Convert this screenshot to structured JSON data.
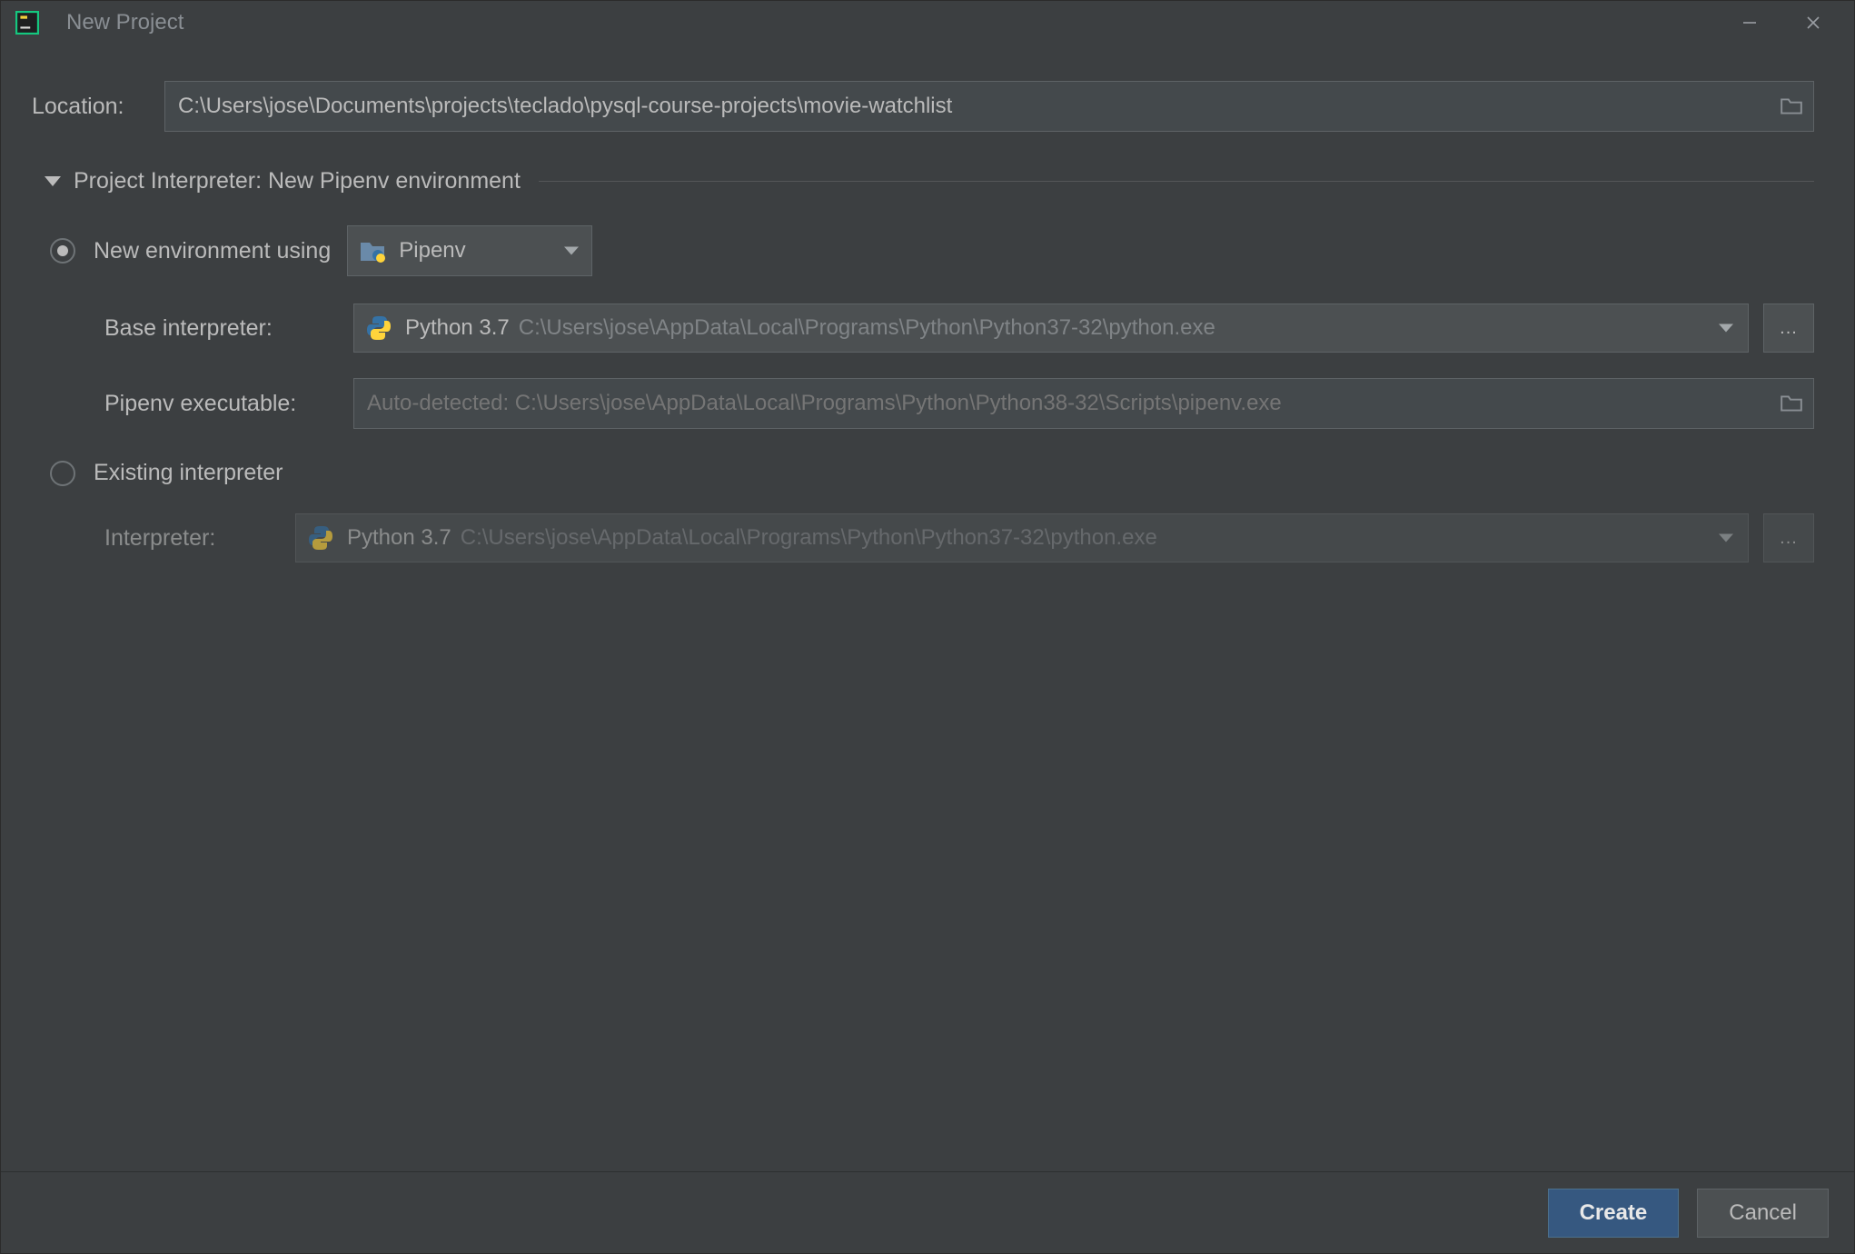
{
  "titlebar": {
    "title": "New Project"
  },
  "location": {
    "label": "Location:",
    "value": "C:\\Users\\jose\\Documents\\projects\\teclado\\pysql-course-projects\\movie-watchlist"
  },
  "section": {
    "heading": "Project Interpreter: New Pipenv environment"
  },
  "new_env": {
    "radio_label": "New environment using",
    "tool": "Pipenv",
    "base_interpreter_label": "Base interpreter:",
    "base_interpreter_name": "Python 3.7",
    "base_interpreter_path": "C:\\Users\\jose\\AppData\\Local\\Programs\\Python\\Python37-32\\python.exe",
    "pipenv_exe_label": "Pipenv executable:",
    "pipenv_exe_value": "Auto-detected: C:\\Users\\jose\\AppData\\Local\\Programs\\Python\\Python38-32\\Scripts\\pipenv.exe"
  },
  "existing": {
    "radio_label": "Existing interpreter",
    "interpreter_label": "Interpreter:",
    "interpreter_name": "Python 3.7",
    "interpreter_path": "C:\\Users\\jose\\AppData\\Local\\Programs\\Python\\Python37-32\\python.exe"
  },
  "footer": {
    "create": "Create",
    "cancel": "Cancel"
  },
  "ellipsis": "..."
}
